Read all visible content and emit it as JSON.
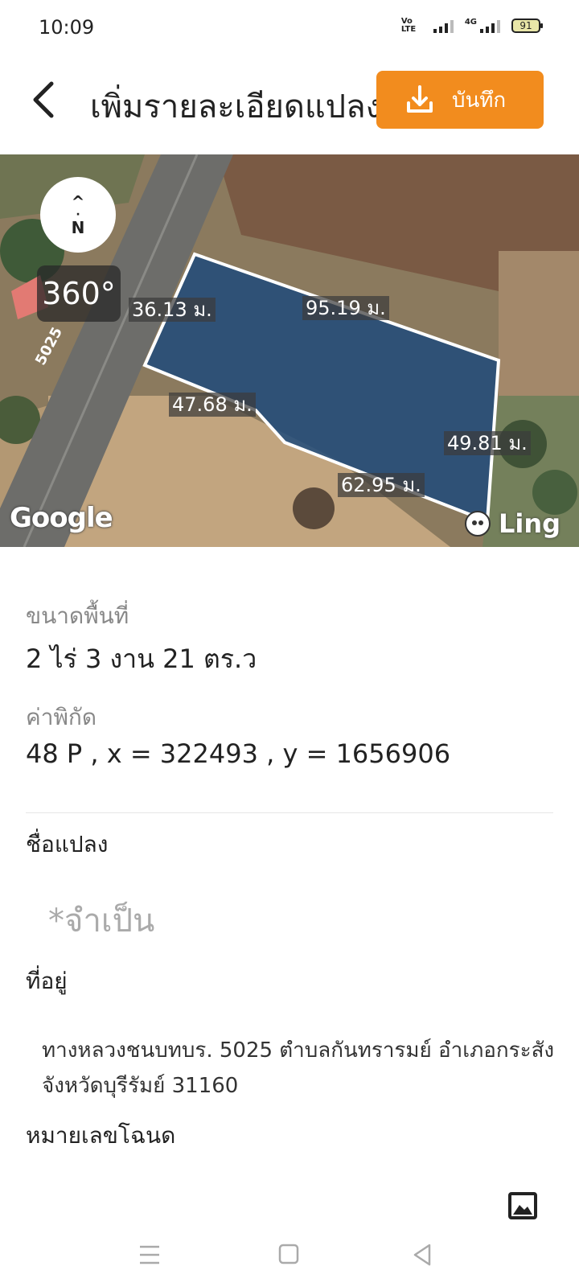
{
  "status_bar": {
    "time": "10:09",
    "volte_label": "Vo LTE",
    "network_label": "4G",
    "battery_level": "91"
  },
  "header": {
    "title": "เพิ่มรายละเอียดแปลง",
    "save_label": "บันทึก",
    "accent_color": "#f28c1e"
  },
  "map": {
    "compass_label": "N",
    "view_360_label": "360°",
    "road_number": "5025",
    "dimensions": [
      "36.13 ม.",
      "95.19 ม.",
      "47.68 ม.",
      "49.81 ม.",
      "62.95 ม."
    ],
    "provider_logo": "Google",
    "brand_label": "Ling"
  },
  "details": {
    "area_label": "ขนาดพื้นที่",
    "area_value": "2 ไร่ 3 งาน 21 ตร.ว",
    "coord_label": "ค่าพิกัด",
    "coord_value": "48 P , x = 322493 , y = 1656906",
    "plot_name_label": "ชื่อแปลง",
    "plot_name_placeholder": "*จำเป็น",
    "address_label": "ที่อยู่",
    "address_value": "ทางหลวงชนบทบร. 5025 ตำบลกันทรารมย์ อำเภอกระสัง จังหวัดบุรีรัมย์ 31160",
    "deed_label": "หมายเลขโฉนด"
  },
  "icons": {
    "back": "back-arrow-icon",
    "save": "download-icon",
    "image": "image-icon",
    "nav_menu": "menu-icon",
    "nav_home": "home-icon",
    "nav_back": "back-triangle-icon"
  }
}
